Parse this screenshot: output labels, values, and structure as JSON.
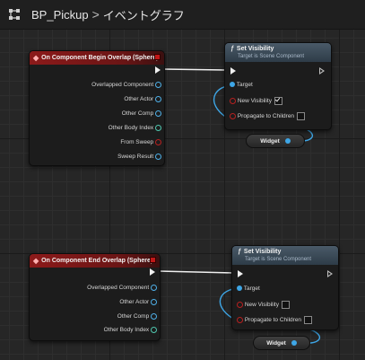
{
  "breadcrumb": {
    "blueprint": "BP_Pickup",
    "separator": ">",
    "graph": "イベントグラフ"
  },
  "nodes": {
    "begin_overlap": {
      "title": "On Component Begin Overlap (Sphere)",
      "pins": [
        "Overlapped Component",
        "Other Actor",
        "Other Comp",
        "Other Body Index",
        "From Sweep",
        "Sweep Result"
      ]
    },
    "set_visibility_1": {
      "title": "Set Visibility",
      "subtitle": "Target is Scene Component",
      "target_label": "Target",
      "new_visibility_label": "New Visibility",
      "new_visibility_checked": true,
      "propagate_label": "Propagate to Children",
      "propagate_checked": false
    },
    "widget_1": {
      "label": "Widget"
    },
    "end_overlap": {
      "title": "On Component End Overlap (Sphere)",
      "pins": [
        "Overlapped Component",
        "Other Actor",
        "Other Comp",
        "Other Body Index"
      ]
    },
    "set_visibility_2": {
      "title": "Set Visibility",
      "subtitle": "Target is Scene Component",
      "target_label": "Target",
      "new_visibility_label": "New Visibility",
      "new_visibility_checked": false,
      "propagate_label": "Propagate to Children",
      "propagate_checked": false
    },
    "widget_2": {
      "label": "Widget"
    }
  },
  "colors": {
    "event_header": "#8c1a1a",
    "function_header": "#3a4a58",
    "object_pin": "#4fb0e8",
    "bool_pin": "#b82020",
    "int_pin": "#50c8b0",
    "exec_wire": "#f0f0f0"
  },
  "icons": [
    "graph-icon",
    "event-icon",
    "function-icon"
  ]
}
